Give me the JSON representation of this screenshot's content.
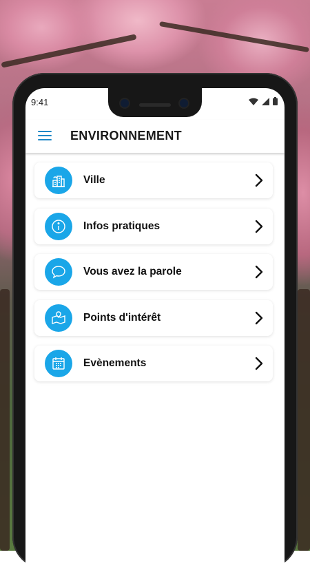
{
  "status_bar": {
    "time": "9:41"
  },
  "app_bar": {
    "title": "ENVIRONNEMENT"
  },
  "menu": {
    "items": [
      {
        "label": "Ville",
        "icon": "city-buildings-icon"
      },
      {
        "label": "Infos pratiques",
        "icon": "info-icon"
      },
      {
        "label": "Vous avez la parole",
        "icon": "speech-bubble-icon"
      },
      {
        "label": "Points d'intérêt",
        "icon": "map-pin-icon"
      },
      {
        "label": "Evènements",
        "icon": "calendar-icon"
      }
    ]
  },
  "colors": {
    "accent": "#1aa6e8",
    "menu_icon": "#1e88c7"
  }
}
